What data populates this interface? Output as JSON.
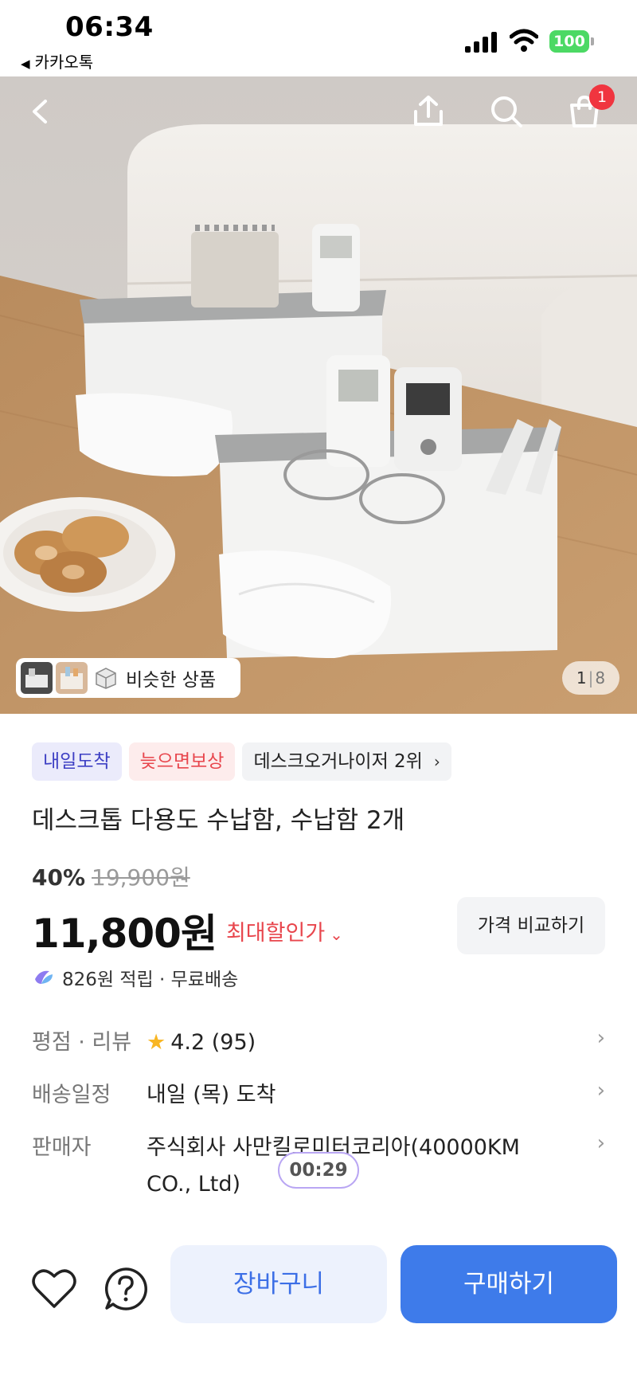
{
  "status_bar": {
    "time": "06:34",
    "back_app": "카카오톡",
    "battery": "100",
    "signal_icon": "signal-icon",
    "wifi_icon": "wifi-icon"
  },
  "hero": {
    "similar_label": "비슷한 상품",
    "cart_badge": "1",
    "page_current": "1",
    "page_total": "8",
    "icons": [
      "back-arrow-icon",
      "share-icon",
      "search-icon",
      "cart-icon"
    ]
  },
  "product": {
    "tags": [
      {
        "label": "내일도착",
        "style": "blue"
      },
      {
        "label": "늦으면보상",
        "style": "red"
      },
      {
        "label": "데스크오거나이저 2위",
        "style": "gray"
      }
    ],
    "title": "데스크톱 다용도 수납함, 수납함 2개",
    "discount_percent": "40%",
    "original_price": "19,900원",
    "price": "11,800원",
    "max_discount_label": "최대할인가",
    "compare_button": "가격 비교하기",
    "points_text": "826원 적립 · 무료배송"
  },
  "info": {
    "rating_label": "평점 · 리뷰",
    "rating_value": "4.2",
    "review_count": "(95)",
    "delivery_label": "배송일정",
    "delivery_value": "내일 (목) 도착",
    "seller_label": "판매자",
    "seller_line1": "주식회사 사만킬로미터코리아(40000KM",
    "seller_line2": "CO., Ltd)",
    "timer": "00:29"
  },
  "bottom_bar": {
    "cart_button": "장바구니",
    "buy_button": "구매하기"
  },
  "colors": {
    "accent": "#3e7bea",
    "discount_red": "#e8464d",
    "tag_blue_text": "#3e40c4",
    "battery_green": "#4cd964"
  }
}
